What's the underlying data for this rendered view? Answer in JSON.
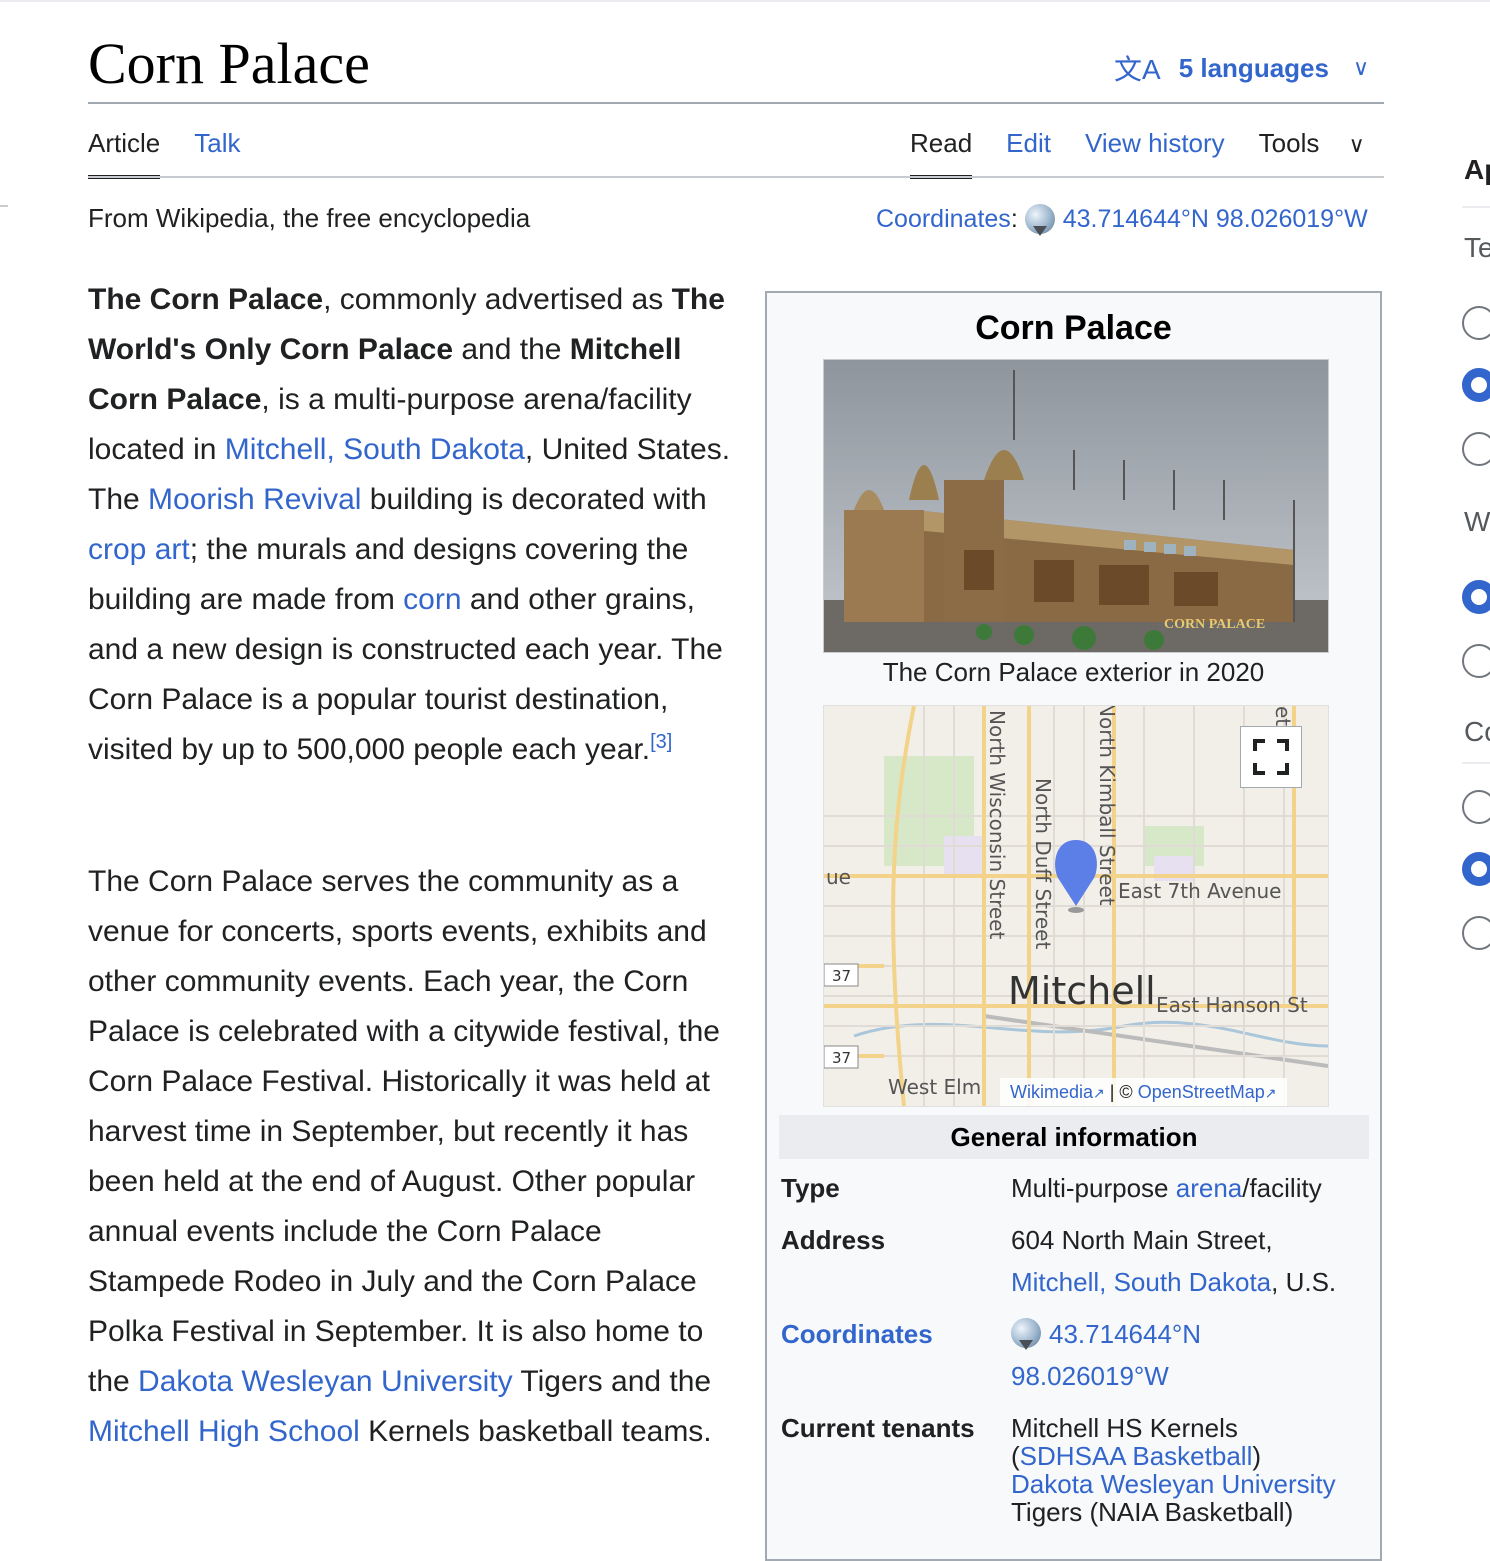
{
  "page": {
    "title": "Corn Palace",
    "languages_label": "5 languages",
    "tagline": "From Wikipedia, the free encyclopedia"
  },
  "tabs": {
    "left": [
      "Article",
      "Talk"
    ],
    "right": [
      "Read",
      "Edit",
      "View history",
      "Tools"
    ]
  },
  "coordinates": {
    "label": "Coordinates",
    "value": "43.714644°N 98.026019°W"
  },
  "paragraph1": {
    "b1": "The Corn Palace",
    "t1": ", commonly advertised as ",
    "b2": "The World's Only Corn Palace",
    "t2": " and the ",
    "b3": "Mitchell Corn Palace",
    "t3": ", is a multi-purpose arena/facility located in ",
    "l1": "Mitchell, South Dakota",
    "t4": ", United States. The ",
    "l2": "Moorish Revival",
    "t5": " building is decorated with ",
    "l3": "crop art",
    "t6": "; the murals and designs covering the building are made from ",
    "l4": "corn",
    "t7": " and other grains, and a new design is constructed each year. The Corn Palace is a popular tourist destination, visited by up to 500,000 people each year.",
    "ref": "[3]"
  },
  "paragraph2": {
    "t1": "The Corn Palace serves the community as a venue for concerts, sports events, exhibits and other community events. Each year, the Corn Palace is celebrated with a citywide festival, the Corn Palace Festival. Historically it was held at harvest time in September, but recently it has been held at the end of August. Other popular annual events include the Corn Palace Stampede Rodeo in July and the Corn Palace Polka Festival in September. It is also home to the ",
    "l1": "Dakota Wesleyan University",
    "t2": " Tigers and the ",
    "l2": "Mitchell High School",
    "t3": " Kernels basketball teams."
  },
  "infobox": {
    "title": "Corn Palace",
    "caption": "The Corn Palace exterior in 2020",
    "photo_sign": "CORN PALACE",
    "map": {
      "labels": {
        "wisconsin": "North Wisconsin Street",
        "duff": "North Duff Street",
        "kimball": "North Kimball Street",
        "seventh": "East 7th Avenue",
        "hanson": "East Hanson St",
        "city": "Mitchell",
        "elm": "West Elm",
        "ue": "ue",
        "et": "et",
        "route1": "37",
        "route2": "37"
      },
      "attr_wikimedia": "Wikimedia",
      "attr_sep": " | © ",
      "attr_osm": "OpenStreetMap"
    },
    "section": "General information",
    "rows": {
      "type_label": "Type",
      "type_pre": "Multi-purpose ",
      "type_link": "arena",
      "type_post": "/facility",
      "address_label": "Address",
      "address_line1": "604 North Main Street,",
      "address_link": "Mitchell, South Dakota",
      "address_post": ", U.S.",
      "coord_label": "Coordinates",
      "coord_line1": "43.714644°N",
      "coord_line2": "98.026019°W",
      "tenants_label": "Current tenants",
      "tenant1": "Mitchell HS Kernels",
      "tenant1_open": "(",
      "tenant1_link": "SDHSAA Basketball",
      "tenant1_close": ")",
      "tenant2_link": "Dakota Wesleyan University",
      "tenant3": "Tigers (NAIA Basketball)"
    }
  },
  "sidebar": {
    "head": "Ap",
    "group1": "Te",
    "group2": "W",
    "group3": "Co"
  },
  "colors": {
    "link": "#3366cc",
    "text": "#202122",
    "infobox_bg": "#f8f9fa",
    "section_bg": "#eaecf0"
  }
}
